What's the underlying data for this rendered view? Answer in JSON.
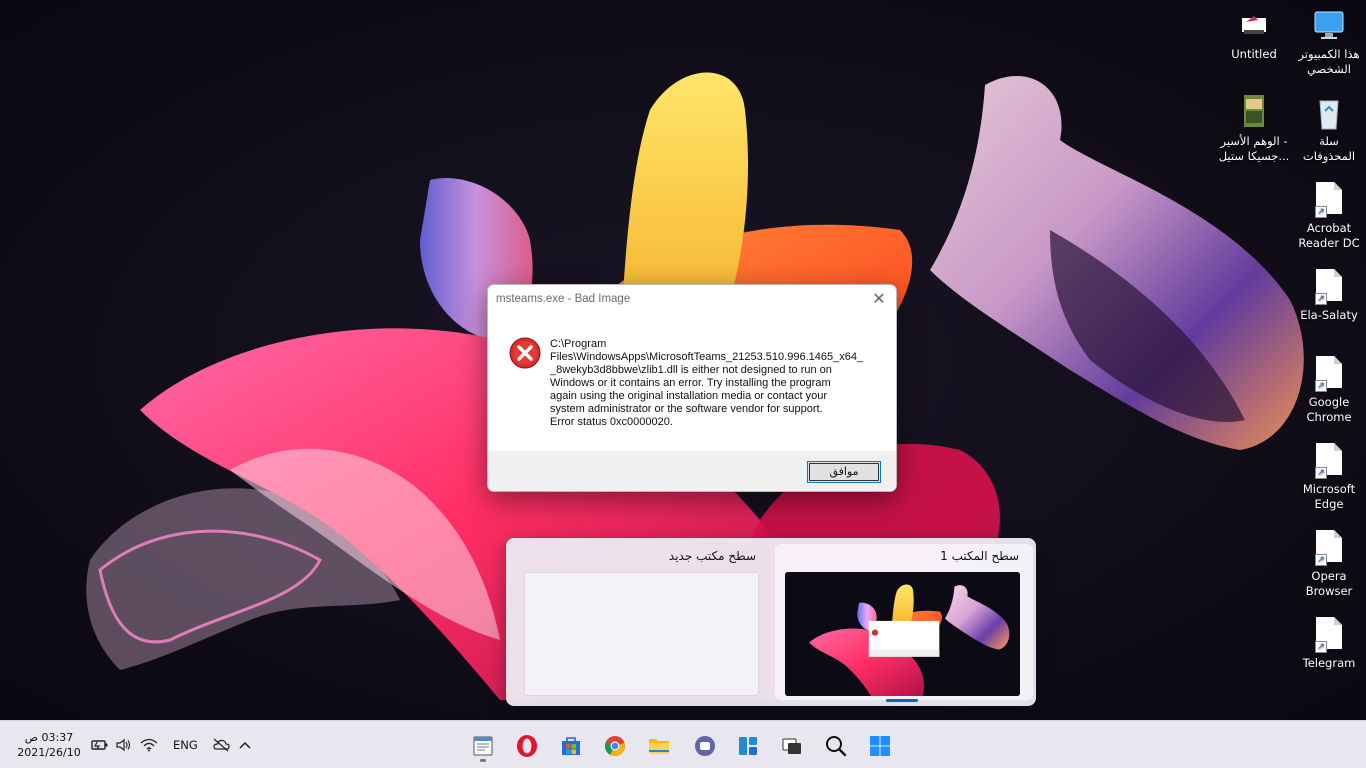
{
  "desktop": {
    "icons": [
      {
        "label": "هذا الكمبيوتر\nالشخصي",
        "icon": "this-pc-icon"
      },
      {
        "label": "Untitled",
        "icon": "paint-file-icon"
      },
      {
        "label": "سلة\nالمحذوفات",
        "icon": "recycle-bin-icon"
      },
      {
        "label": "الوهم الأسير -\nجسيكا ستيل...",
        "icon": "book-cover-icon"
      },
      {
        "label": "Acrobat\nReader DC",
        "icon": "shortcut-file-icon"
      },
      {
        "label": "Ela-Salaty",
        "icon": "shortcut-file-icon"
      },
      {
        "label": "Google\nChrome",
        "icon": "shortcut-file-icon"
      },
      {
        "label": "Microsoft\nEdge",
        "icon": "shortcut-file-icon"
      },
      {
        "label": "Opera\nBrowser",
        "icon": "shortcut-file-icon"
      },
      {
        "label": "Telegram",
        "icon": "shortcut-file-icon"
      }
    ]
  },
  "dialog": {
    "title": "msteams.exe - Bad Image",
    "message": "C:\\Program\nFiles\\WindowsApps\\MicrosoftTeams_21253.510.996.1465_x64_\n_8wekyb3d8bbwe\\zlib1.dll is either not designed to run on\nWindows or it contains an error. Try installing the program\nagain using the original installation media or contact your\nsystem administrator or the software vendor for support.\nError status 0xc0000020.",
    "ok_label": "موافق",
    "close_glyph": "✕",
    "icon": "error-icon"
  },
  "taskview": {
    "desktops": [
      {
        "name": "سطح المكتب 1",
        "current": true
      },
      {
        "name": "سطح مكتب جديد",
        "current": false
      }
    ]
  },
  "taskbar": {
    "apps": [
      {
        "name": "notepad-app-icon"
      },
      {
        "name": "opera-icon"
      },
      {
        "name": "microsoft-store-icon"
      },
      {
        "name": "chrome-icon"
      },
      {
        "name": "file-explorer-icon"
      },
      {
        "name": "teams-chat-icon"
      },
      {
        "name": "widgets-icon"
      },
      {
        "name": "task-view-icon"
      },
      {
        "name": "search-icon"
      },
      {
        "name": "start-icon"
      }
    ],
    "clock": {
      "time": "03:37 ص",
      "date": "2021/26/10"
    },
    "language": "ENG",
    "tray": [
      "battery-icon",
      "volume-icon",
      "wifi-icon",
      "onedrive-icon",
      "chevron-up-icon"
    ]
  },
  "colors": {
    "accent": "#0067c0",
    "error_red": "#d32f2f",
    "taskbar_bg": "#e8e6ee"
  }
}
